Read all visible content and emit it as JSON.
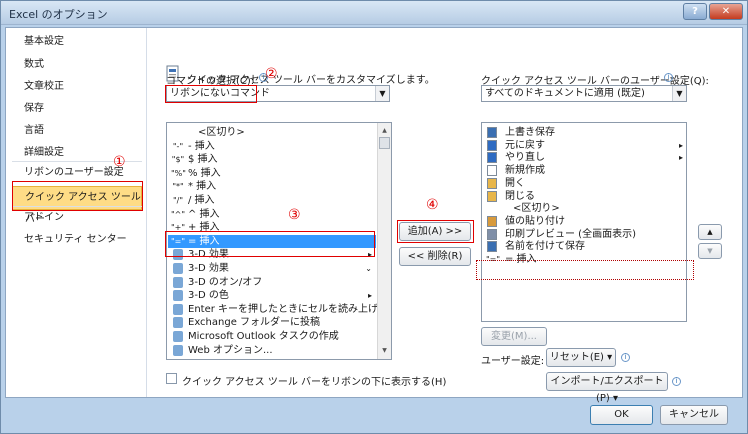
{
  "window": {
    "title": "Excel のオプション",
    "help": "?",
    "close": "✕"
  },
  "nav": {
    "items": [
      "基本設定",
      "数式",
      "文章校正",
      "保存",
      "言語",
      "詳細設定",
      "リボンのユーザー設定",
      "クイック アクセス ツール バー",
      "アドイン",
      "セキュリティ センター"
    ],
    "selected_index": 7
  },
  "header": {
    "text": "クイック アクセス ツール バーをカスタマイズします。"
  },
  "left": {
    "label": "コマンドの選択(C):",
    "combo_value": "リボンにないコマンド",
    "items": [
      {
        "icon": "",
        "label": "<区切り>"
      },
      {
        "icon": "-",
        "label": "- 挿入"
      },
      {
        "icon": "$",
        "label": "$ 挿入"
      },
      {
        "icon": "%",
        "label": "% 挿入"
      },
      {
        "icon": "*",
        "label": "* 挿入"
      },
      {
        "icon": "/",
        "label": "/ 挿入"
      },
      {
        "icon": "^",
        "label": "^ 挿入"
      },
      {
        "icon": "+",
        "label": "+ 挿入"
      },
      {
        "icon": "=",
        "label": "= 挿入"
      },
      {
        "icon": "",
        "label": "3-D 効果",
        "arrow": "▸"
      },
      {
        "icon": "",
        "label": "3-D 効果",
        "arrow": "⌄"
      },
      {
        "icon": "",
        "label": "3-D のオン/オフ"
      },
      {
        "icon": "",
        "label": "3-D の色",
        "arrow": "▸"
      },
      {
        "icon": "",
        "label": "Enter キーを押したときにセルを読み上げ"
      },
      {
        "icon": "",
        "label": "Exchange フォルダーに投稿"
      },
      {
        "icon": "",
        "label": "Microsoft Outlook タスクの作成"
      },
      {
        "icon": "",
        "label": "Web オプション..."
      }
    ],
    "selected_index": 8,
    "checkbox_label": "クイック アクセス ツール バーをリボンの下に表示する(H)"
  },
  "middle": {
    "add_label": "追加(A) >>",
    "remove_label": "<< 削除(R)"
  },
  "right": {
    "label": "クイック アクセス ツール バーのユーザー設定(Q):",
    "combo_value": "すべてのドキュメントに適用 (既定)",
    "items": [
      {
        "icon": "save",
        "label": "上書き保存"
      },
      {
        "icon": "undo",
        "label": "元に戻す",
        "arrow": "▸"
      },
      {
        "icon": "redo",
        "label": "やり直し",
        "arrow": "▸"
      },
      {
        "icon": "new",
        "label": "新規作成"
      },
      {
        "icon": "open",
        "label": "開く"
      },
      {
        "icon": "close",
        "label": "閉じる"
      },
      {
        "icon": "",
        "label": "<区切り>"
      },
      {
        "icon": "paste",
        "label": "値の貼り付け"
      },
      {
        "icon": "preview",
        "label": "印刷プレビュー (全画面表示)"
      },
      {
        "icon": "saveas",
        "label": "名前を付けて保存"
      },
      {
        "icon": "=",
        "label": "= 挿入"
      }
    ],
    "modify_label": "変更(M)...",
    "user_settings_label": "ユーザー設定:",
    "reset_label": "リセット(E) ▾",
    "import_label": "インポート/エクスポート(P) ▾"
  },
  "annotations": [
    "①",
    "②",
    "③",
    "④"
  ],
  "footer": {
    "ok": "OK",
    "cancel": "キャンセル"
  }
}
